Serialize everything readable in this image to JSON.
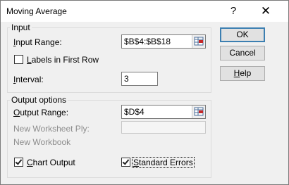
{
  "window": {
    "title": "Moving Average",
    "help_glyph": "?",
    "close_glyph": "✕"
  },
  "input": {
    "group_label": "Input",
    "input_range_pre": "",
    "input_range_key": "I",
    "input_range_post": "nput Range:",
    "input_range_value": "$B$4:$B$18",
    "labels_pre": "",
    "labels_key": "L",
    "labels_post": "abels in First Row",
    "labels_checked": false,
    "interval_pre": "",
    "interval_key": "I",
    "interval_post": "nterval:",
    "interval_value": "3"
  },
  "output": {
    "group_label": "Output options",
    "output_range_pre": "",
    "output_range_key": "O",
    "output_range_post": "utput Range:",
    "output_range_value": "$D$4",
    "new_ply_label": "New Worksheet Ply:",
    "new_ply_value": "",
    "new_workbook_label": "New Workbook",
    "chart_pre": "",
    "chart_key": "C",
    "chart_post": "hart Output",
    "chart_checked": true,
    "stderr_pre": "",
    "stderr_key": "S",
    "stderr_post": "tandard Errors",
    "stderr_checked": true
  },
  "buttons": {
    "ok": "OK",
    "cancel": "Cancel",
    "help_pre": "",
    "help_key": "H",
    "help_post": "elp"
  },
  "icons": {
    "refedit": "range-selector-icon"
  }
}
